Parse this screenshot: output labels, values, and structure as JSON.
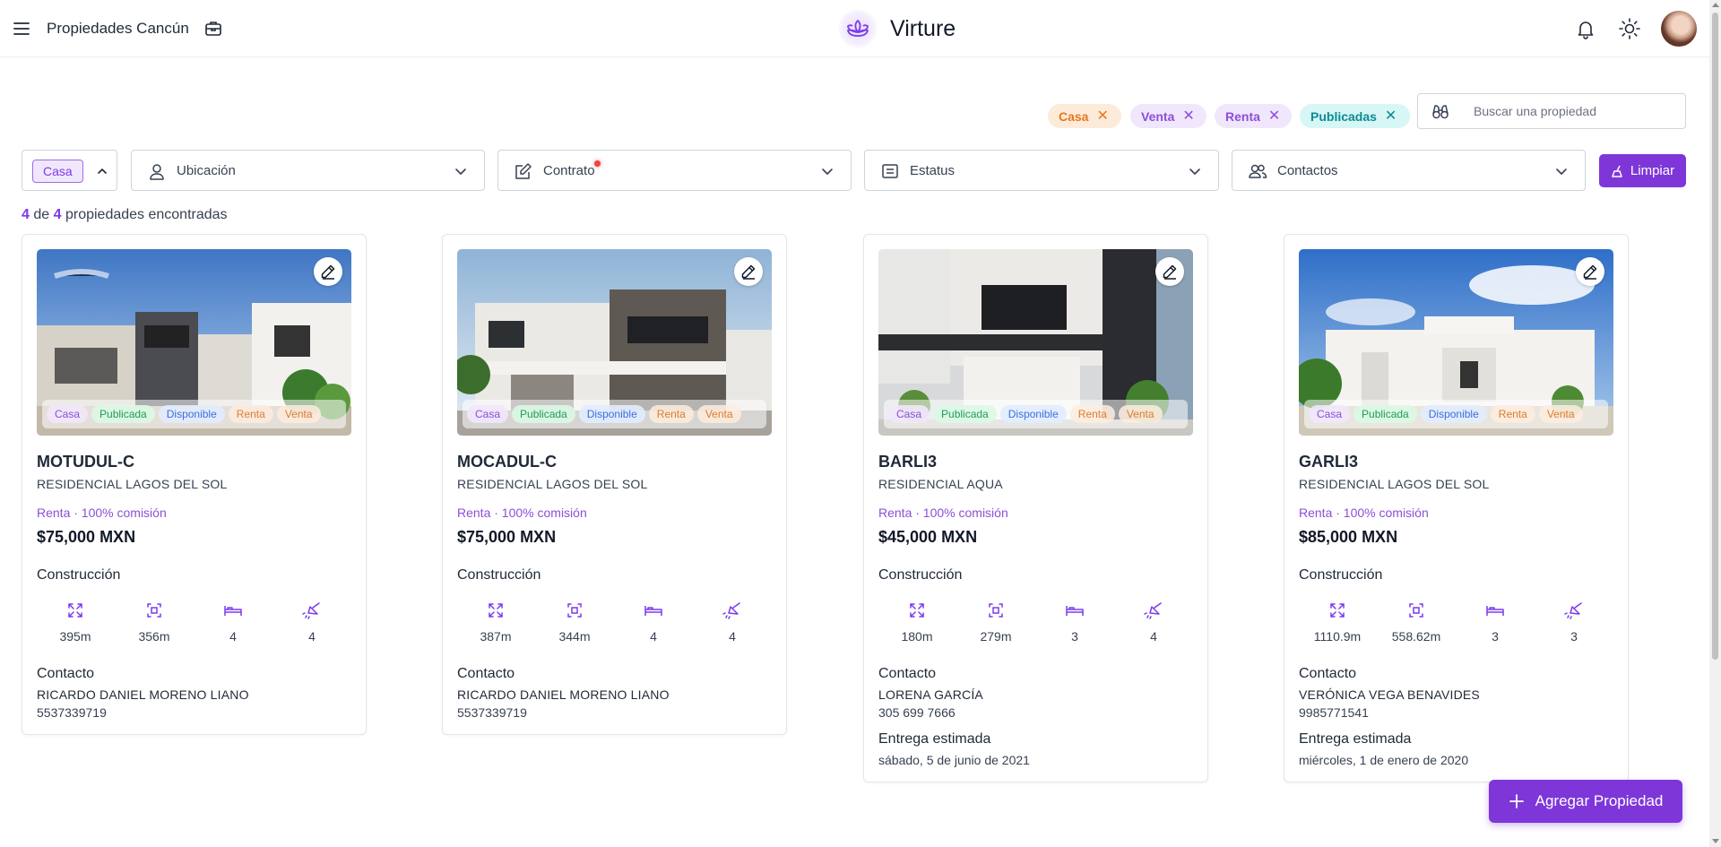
{
  "header": {
    "site_title": "Propiedades Cancún",
    "brand": "Virture"
  },
  "active_filters": {
    "chips": [
      "Casa",
      "Venta",
      "Renta",
      "Publicadas"
    ],
    "remove_symbol": "✕"
  },
  "search": {
    "placeholder": "Buscar una propiedad"
  },
  "filters": {
    "type_selected": "Casa",
    "ubicacion": "Ubicación",
    "contrato": "Contrato",
    "estatus": "Estatus",
    "contactos": "Contactos",
    "clear_label": "Limpiar"
  },
  "results": {
    "shown": "4",
    "connector": "de",
    "total": "4",
    "suffix": "propiedades encontradas"
  },
  "card_labels": {
    "construction": "Construcción",
    "contact": "Contacto",
    "delivery": "Entrega estimada",
    "tags": [
      "Casa",
      "Publicada",
      "Disponible",
      "Renta",
      "Venta"
    ]
  },
  "properties": [
    {
      "code": "MOTUDUL-C",
      "development": "RESIDENCIAL LAGOS DEL SOL",
      "operation": "Renta · 100% comisión",
      "price": "$75,000 MXN",
      "features": [
        "395m",
        "356m",
        "4",
        "4"
      ],
      "contact_name": "RICARDO DANIEL MORENO LIANO",
      "contact_phone": "5537339719"
    },
    {
      "code": "MOCADUL-C",
      "development": "RESIDENCIAL LAGOS DEL SOL",
      "operation": "Renta · 100% comisión",
      "price": "$75,000 MXN",
      "features": [
        "387m",
        "344m",
        "4",
        "4"
      ],
      "contact_name": "RICARDO DANIEL MORENO LIANO",
      "contact_phone": "5537339719"
    },
    {
      "code": "BARLI3",
      "development": "RESIDENCIAL AQUA",
      "operation": "Renta · 100% comisión",
      "price": "$45,000 MXN",
      "features": [
        "180m",
        "279m",
        "3",
        "4"
      ],
      "contact_name": "LORENA GARCÍA",
      "contact_phone": "305 699 7666",
      "delivery_date": "sábado, 5 de junio de 2021"
    },
    {
      "code": "GARLI3",
      "development": "RESIDENCIAL LAGOS DEL SOL",
      "operation": "Renta · 100% comisión",
      "price": "$85,000 MXN",
      "features": [
        "1110.9m",
        "558.62m",
        "3",
        "3"
      ],
      "contact_name": "VERÓNICA VEGA BENAVIDES",
      "contact_phone": "9985771541",
      "delivery_date": "miércoles, 1 de enero de 2020"
    }
  ],
  "fab_label": "Agregar Propiedad",
  "colors": {
    "accent": "#7e36d9",
    "casa_chip": "#e8771f",
    "venta_chip": "#8b4fd8",
    "publicadas_chip": "#0c8b92"
  },
  "icons": {
    "menu": "menu-icon",
    "briefcase": "briefcase-icon",
    "brand": "lotus-icon",
    "bell": "bell-icon",
    "theme": "sun-icon",
    "search": "binoculars-icon",
    "ubicacion": "map-pin-user-icon",
    "contrato": "edit-document-icon",
    "estatus": "list-icon",
    "contactos": "users-icon",
    "clear": "broom-icon",
    "edit": "pencil-icon",
    "features": [
      "expand-icon",
      "area-icon",
      "bed-icon",
      "shower-icon"
    ],
    "add": "plus-icon"
  }
}
